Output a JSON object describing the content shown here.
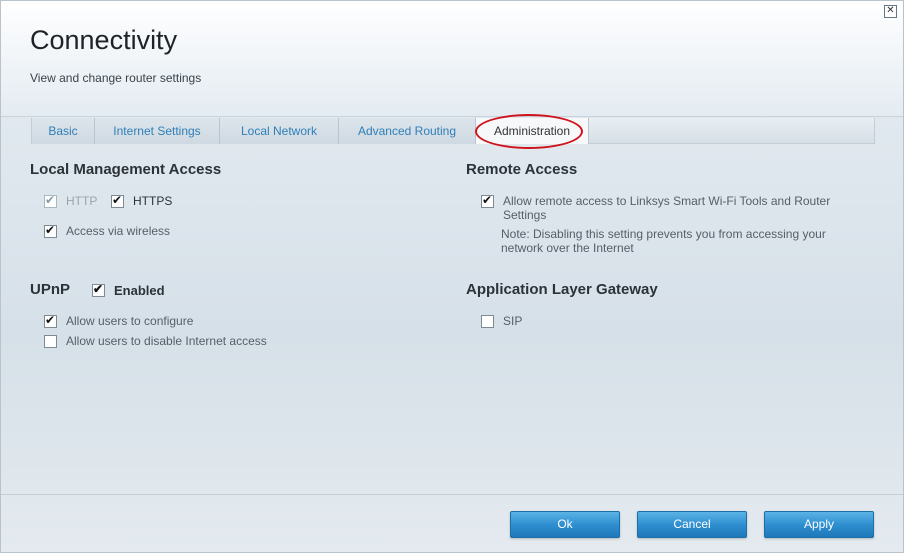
{
  "header": {
    "title": "Connectivity",
    "subtitle": "View and change router settings",
    "close_icon": "close-icon"
  },
  "tabs": [
    {
      "label": "Basic",
      "active": false
    },
    {
      "label": "Internet Settings",
      "active": false
    },
    {
      "label": "Local Network",
      "active": false
    },
    {
      "label": "Advanced Routing",
      "active": false
    },
    {
      "label": "Administration",
      "active": true
    }
  ],
  "local_management": {
    "title": "Local Management Access",
    "http": {
      "label": "HTTP",
      "checked": true,
      "disabled": true
    },
    "https": {
      "label": "HTTPS",
      "checked": true
    },
    "wireless": {
      "label": "Access via wireless",
      "checked": true
    }
  },
  "remote_access": {
    "title": "Remote Access",
    "allow": {
      "label": "Allow remote access to Linksys Smart Wi-Fi Tools and Router Settings",
      "checked": true
    },
    "note": "Note: Disabling this setting prevents you from accessing your network over the Internet"
  },
  "upnp": {
    "title": "UPnP",
    "enabled": {
      "label": "Enabled",
      "checked": true
    },
    "allow_configure": {
      "label": "Allow users to configure",
      "checked": true
    },
    "allow_disable": {
      "label": "Allow users to disable Internet access",
      "checked": false
    }
  },
  "alg": {
    "title": "Application Layer Gateway",
    "sip": {
      "label": "SIP",
      "checked": false
    }
  },
  "footer": {
    "ok": "Ok",
    "cancel": "Cancel",
    "apply": "Apply"
  },
  "colors": {
    "accent": "#2f8fd0",
    "tab_link": "#2f7fb8",
    "highlight_oval": "#d0131b"
  }
}
